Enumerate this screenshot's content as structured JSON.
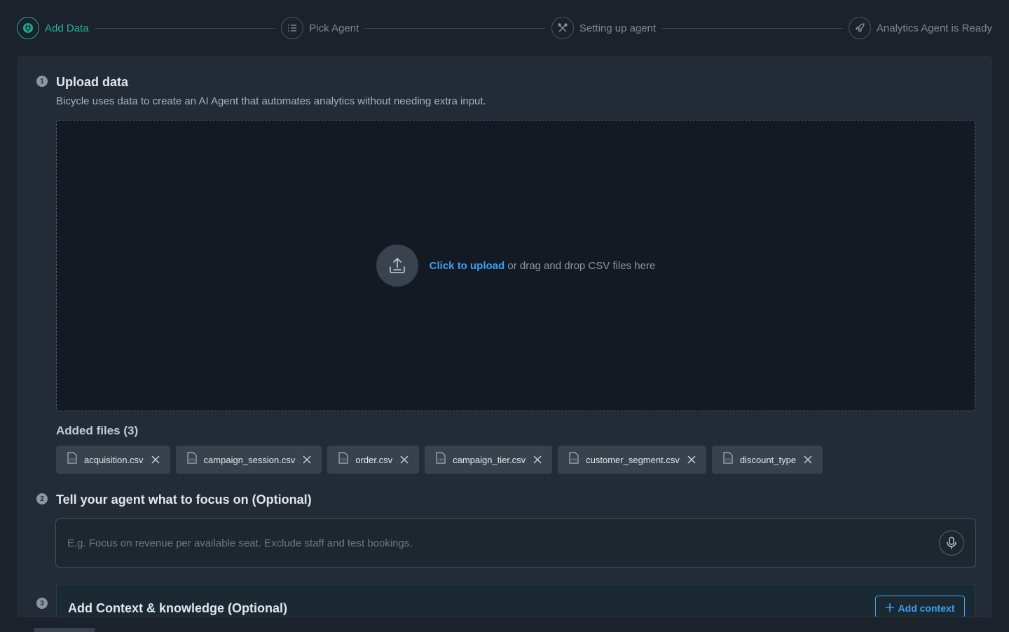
{
  "stepper": {
    "steps": [
      {
        "label": "Add Data",
        "icon": "plug-icon",
        "active": true
      },
      {
        "label": "Pick Agent",
        "icon": "list-icon",
        "active": false
      },
      {
        "label": "Setting up agent",
        "icon": "tools-icon",
        "active": false
      },
      {
        "label": "Analytics Agent is Ready",
        "icon": "rocket-icon",
        "active": false
      }
    ]
  },
  "upload_section": {
    "number": "1",
    "title": "Upload data",
    "description": "Bicycle uses data to create an AI Agent that automates analytics without needing extra input.",
    "dropzone": {
      "link_text": "Click to upload",
      "rest_text": " or drag and drop CSV files here"
    },
    "added_files_title": "Added files (3)",
    "files": [
      "acquisition.csv",
      "campaign_session.csv",
      "order.csv",
      "campaign_tier.csv",
      "customer_segment.csv",
      "discount_type"
    ]
  },
  "focus_section": {
    "number": "2",
    "title": "Tell your agent what to focus on (Optional)",
    "placeholder": "E.g. Focus on revenue per available seat. Exclude staff and test bookings."
  },
  "context_section": {
    "number": "3",
    "title": "Add Context & knowledge (Optional)",
    "button_label": "Add context"
  },
  "colors": {
    "accent": "#22b59b",
    "link": "#3ea0f2",
    "background": "#1b222c",
    "panel": "#232b36"
  }
}
